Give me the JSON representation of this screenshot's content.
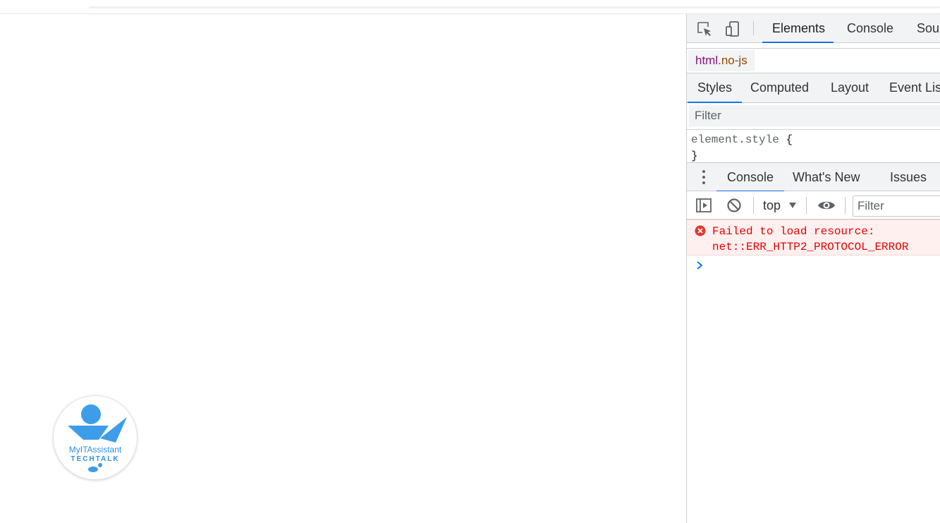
{
  "page": {
    "logo": {
      "line1": "MyITAssistant",
      "line2": "TECHTALK"
    }
  },
  "devtools": {
    "toolbar": {
      "inspect_icon": "inspect-element-icon",
      "device_icon": "device-toolbar-icon",
      "tabs": [
        "Elements",
        "Console",
        "Sour"
      ],
      "active_tab": "Elements"
    },
    "breadcrumb": {
      "tag": "html",
      "class": ".no-js"
    },
    "styles_tabs": [
      "Styles",
      "Computed",
      "Layout",
      "Event List"
    ],
    "styles_active": "Styles",
    "styles_filter_placeholder": "Filter",
    "styles_rule": {
      "selector": "element.style",
      "open": "{",
      "close": "}"
    },
    "drawer": {
      "tabs": [
        "Console",
        "What's New",
        "Issues"
      ],
      "active_tab": "Console"
    },
    "console_toolbar": {
      "context": "top",
      "filter_placeholder": "Filter"
    },
    "console_messages": [
      {
        "level": "error",
        "line1": "Failed to load resource:",
        "line2": "net::ERR_HTTP2_PROTOCOL_ERROR"
      }
    ],
    "colors": {
      "accent": "#1a73e8",
      "error_text": "#e50000",
      "error_bg": "#fff0f0",
      "tag_color": "#881280",
      "class_color": "#994500"
    }
  }
}
